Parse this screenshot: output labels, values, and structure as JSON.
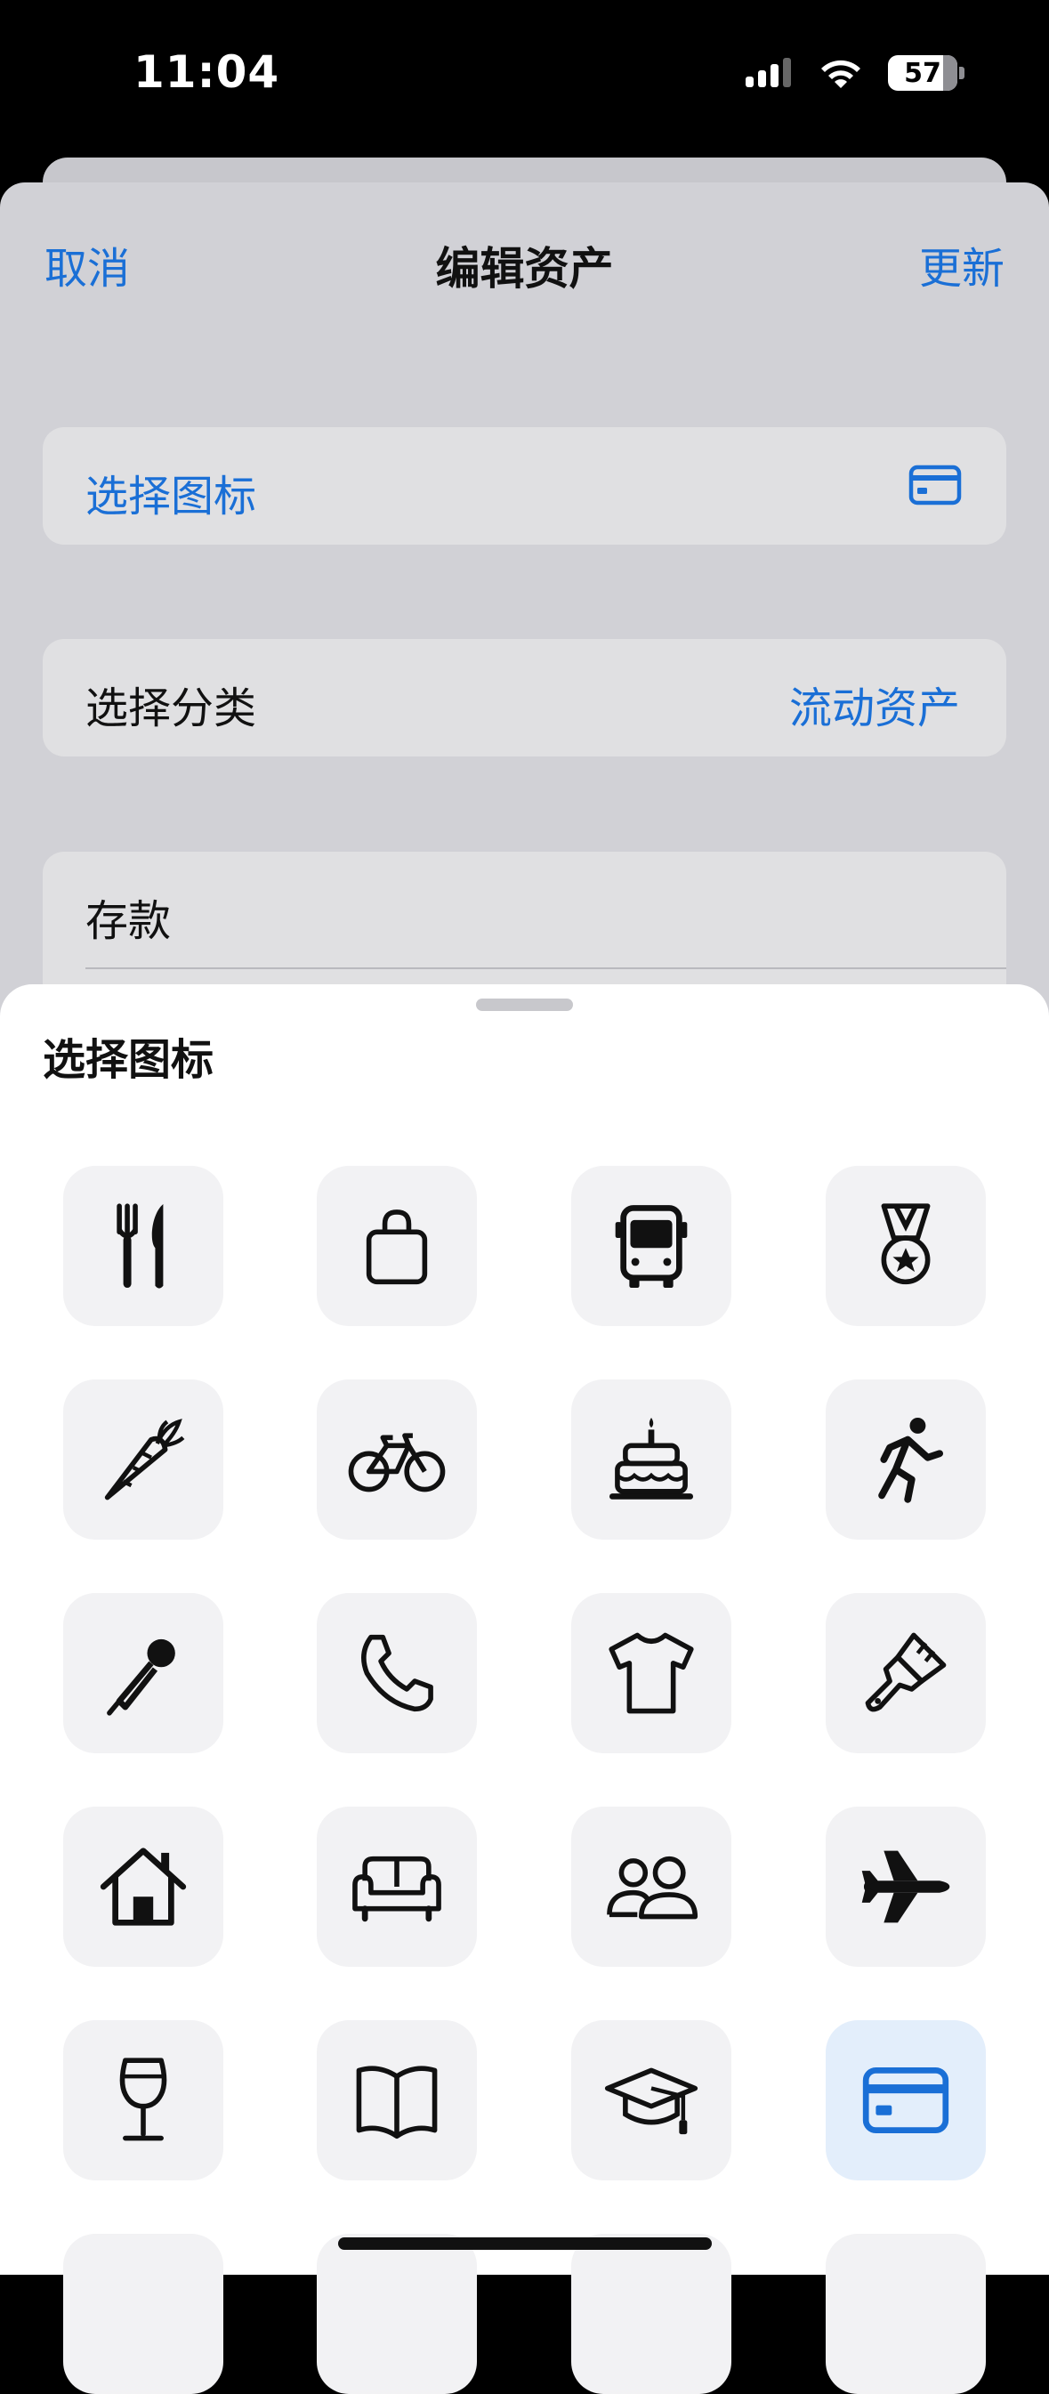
{
  "status_bar": {
    "time": "11:04",
    "battery": "57"
  },
  "nav": {
    "cancel": "取消",
    "title": "编辑资产",
    "update": "更新"
  },
  "form": {
    "icon_row_label": "选择图标",
    "category_label": "选择分类",
    "category_value": "流动资产",
    "name_value": "存款"
  },
  "picker": {
    "title": "选择图标",
    "selected_icon": "card-icon",
    "icons": [
      "fork-knife-icon",
      "bag-icon",
      "bus-icon",
      "medal-icon",
      "carrot-icon",
      "bicycle-icon",
      "cake-icon",
      "runner-icon",
      "microphone-icon",
      "phone-icon",
      "tshirt-icon",
      "paintbrush-icon",
      "house-icon",
      "sofa-icon",
      "people-icon",
      "airplane-icon",
      "wine-glass-icon",
      "book-icon",
      "graduation-cap-icon",
      "card-icon"
    ]
  },
  "colors": {
    "accent": "#1a6fd6",
    "selected_tile": "#e3eefb"
  }
}
